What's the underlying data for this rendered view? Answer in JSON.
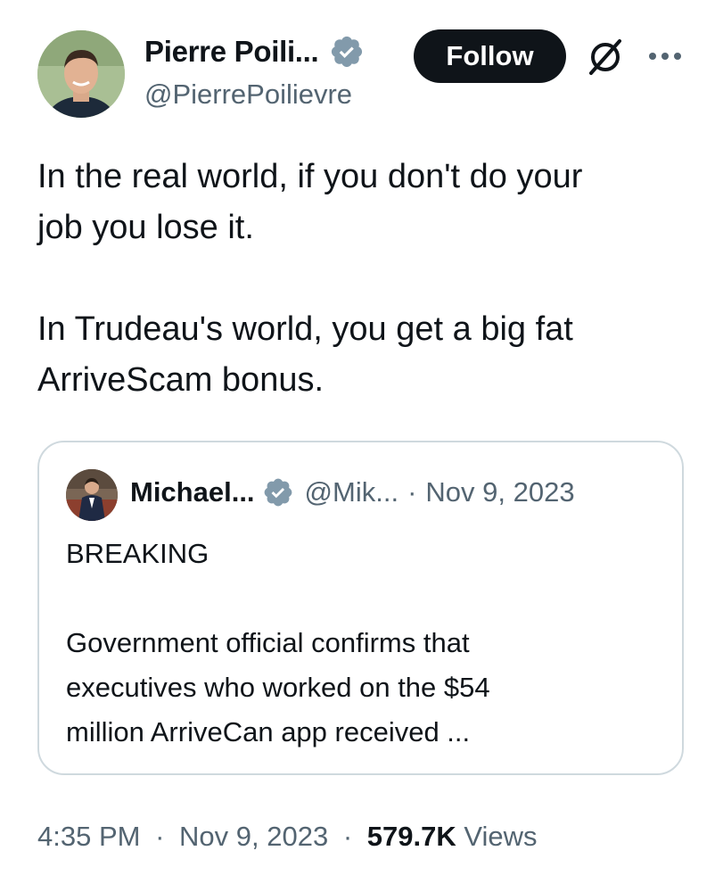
{
  "author": {
    "name": "Pierre Poili...",
    "handle": "@PierrePoilievre",
    "verified_color": "#829aab"
  },
  "actions": {
    "follow_label": "Follow",
    "grok_icon": "grok-icon",
    "more_icon": "more-icon"
  },
  "tweet": {
    "text": "In the real world, if you don't do your\njob you lose it.\n\nIn Trudeau's world, you get a big fat\nArriveScam bonus."
  },
  "quoted": {
    "name": "Michael...",
    "handle": "@Mik...",
    "separator": "·",
    "date": "Nov 9, 2023",
    "text": "BREAKING\n\nGovernment official confirms that\nexecutives who worked on the $54\nmillion ArriveCan app received ..."
  },
  "meta": {
    "time": "4:35 PM",
    "sep1": "·",
    "date": "Nov 9, 2023",
    "sep2": "·",
    "views_count": "579.7K",
    "views_label": "Views"
  }
}
